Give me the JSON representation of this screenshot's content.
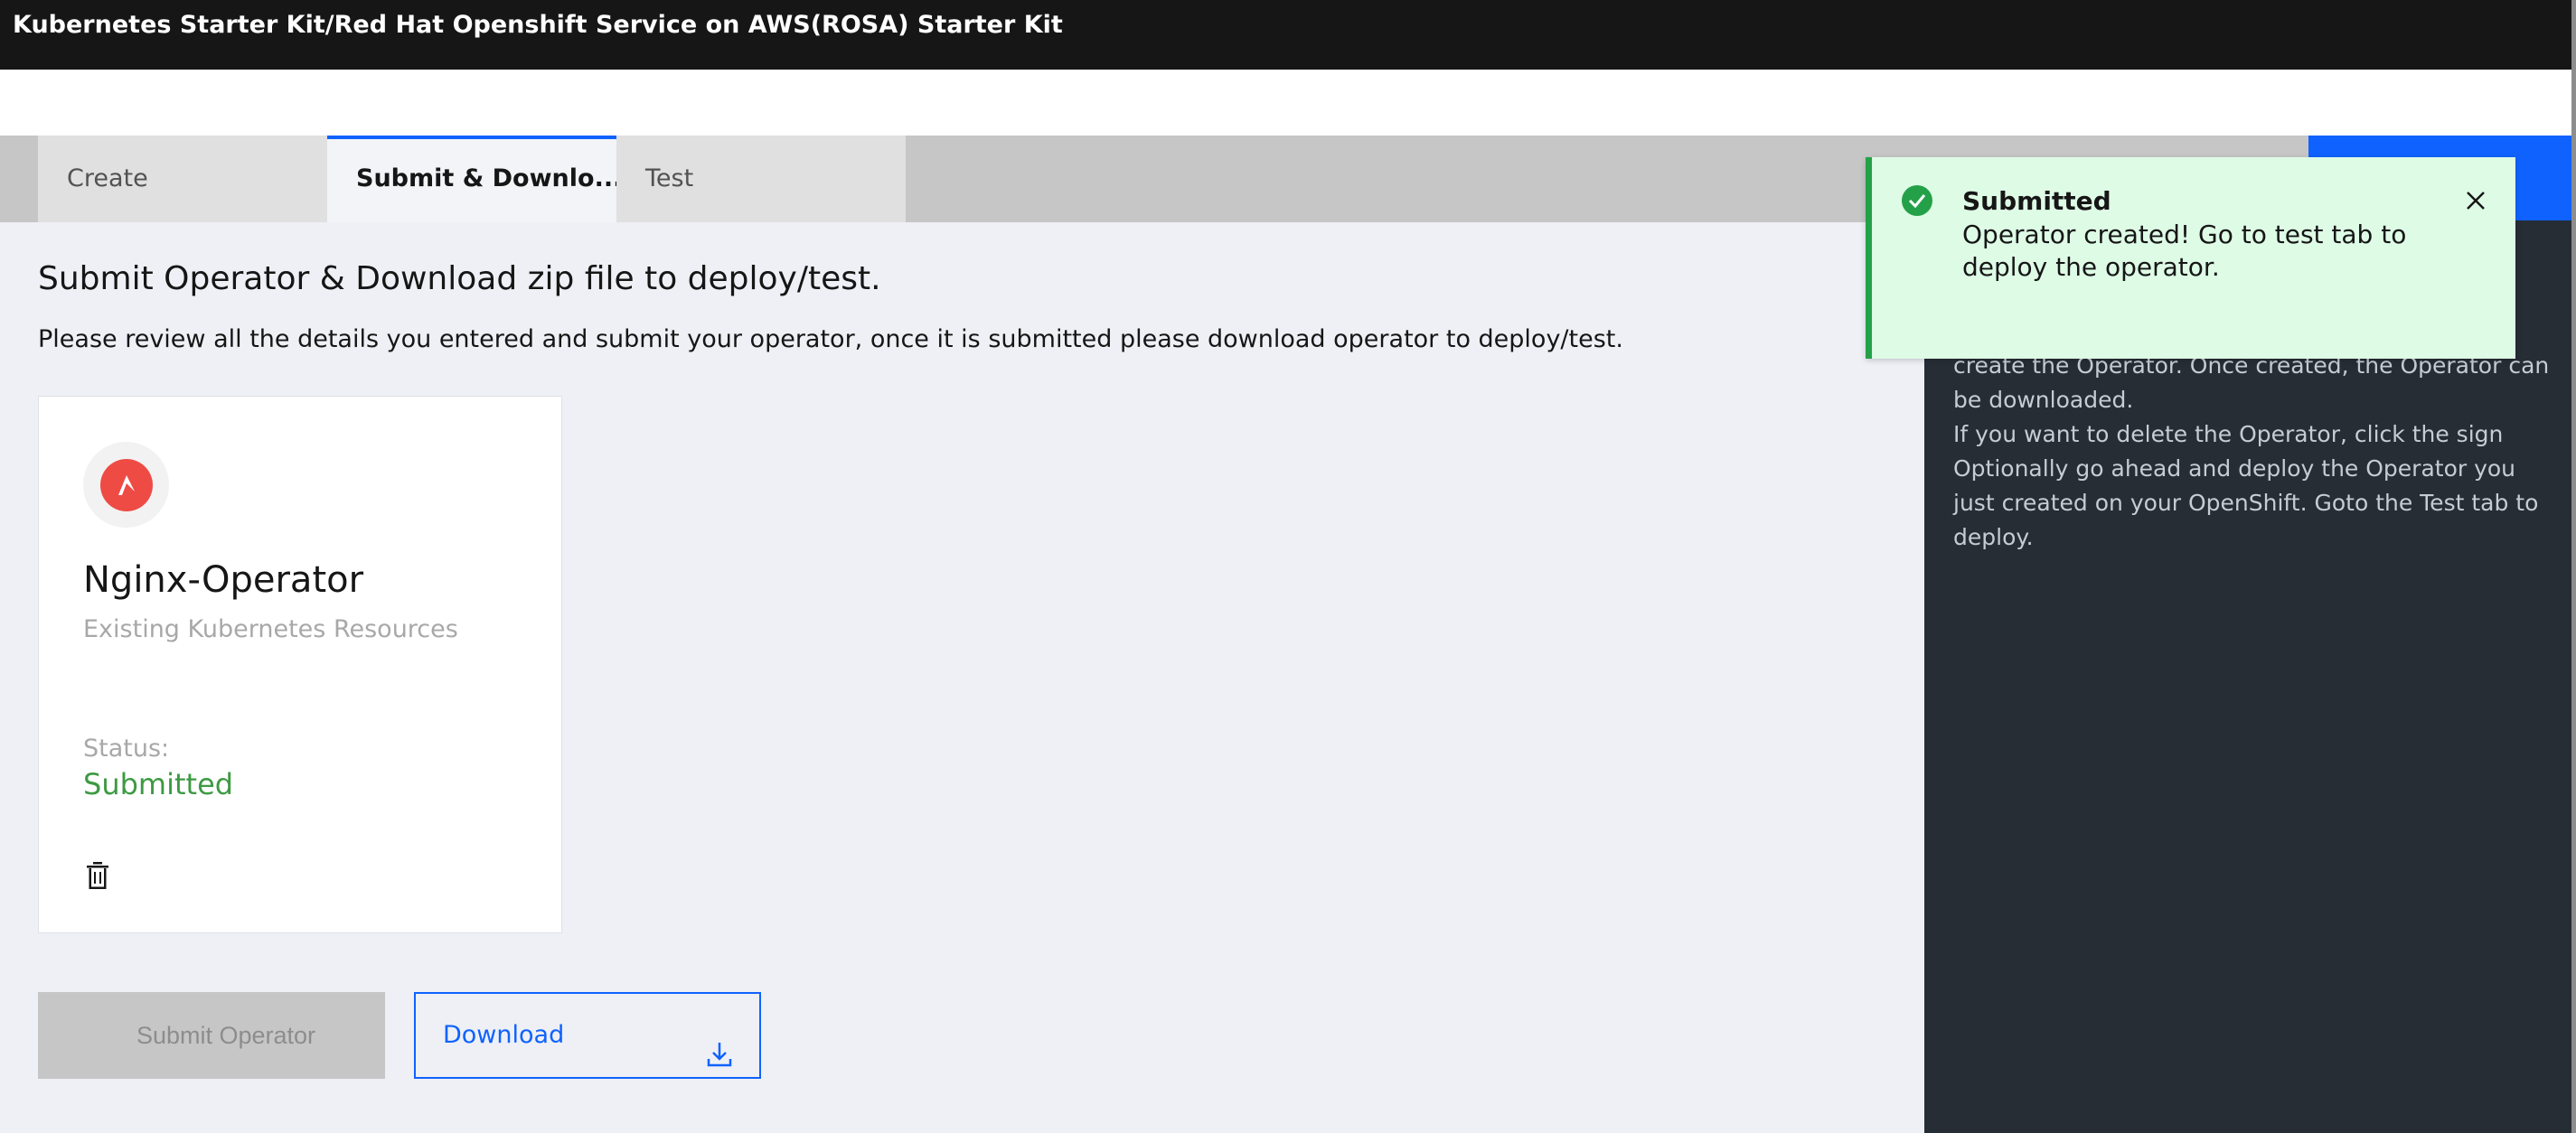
{
  "app": {
    "title": "Kubernetes Starter Kit/Red Hat Openshift Service on AWS(ROSA) Starter Kit"
  },
  "tabs": [
    {
      "label": "Create",
      "active": false
    },
    {
      "label": "Submit & Downlo...",
      "active": true
    },
    {
      "label": "Test",
      "active": false
    }
  ],
  "main": {
    "heading": "Submit Operator & Download zip file to deploy/test.",
    "subtext": "Please review all the details you entered and submit your operator, once it is submitted please download operator to deploy/test."
  },
  "card": {
    "icon": "ansible-logo-icon",
    "title": "Nginx-Operator",
    "subtitle": "Existing Kubernetes Resources",
    "status_label": "Status:",
    "status_value": "Submitted",
    "delete_icon": "trash-icon"
  },
  "buttons": {
    "submit_label": "Submit Operator",
    "download_label": "Download"
  },
  "toast": {
    "title": "Submitted",
    "message": "Operator created! Go to test tab to deploy the operator.",
    "icon": "checkmark-filled-icon",
    "close_icon": "close-icon"
  },
  "help_panel": {
    "lines": [
      "create the Operator. Once created, the Operator can be downloaded.",
      "If you want to delete the Operator, click the sign",
      "Optionally go ahead and deploy the Operator you just created on your OpenShift. Goto the Test tab to deploy."
    ]
  },
  "colors": {
    "accent": "#0f62fe",
    "success": "#24a148",
    "status_green": "#3d9a43",
    "topbar": "#161616",
    "panel": "#262d35",
    "toast_bg": "#defbe6"
  }
}
